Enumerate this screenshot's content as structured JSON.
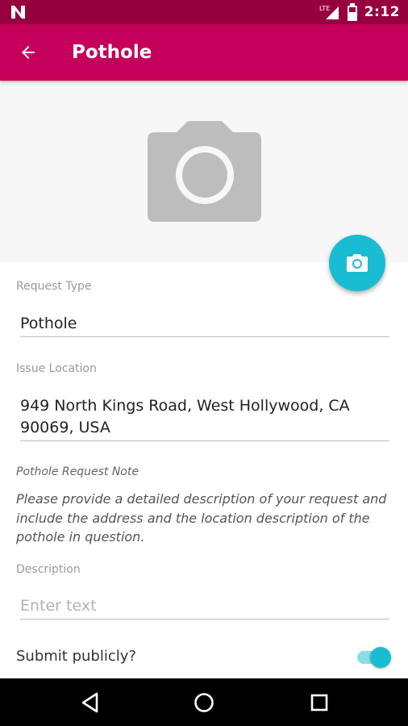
{
  "status_bar": {
    "network": "LTE",
    "time": "2:12"
  },
  "app_bar": {
    "title": "Pothole"
  },
  "form": {
    "request_type": {
      "label": "Request Type",
      "value": "Pothole"
    },
    "issue_location": {
      "label": "Issue Location",
      "value_line1": "949 North Kings Road, West Hollywood, CA",
      "value_line2": "90069, USA"
    },
    "note": {
      "title": "Pothole Request Note",
      "text": "Please provide a detailed description of your request and include the address and the location description of the pothole in question."
    },
    "description": {
      "label": "Description",
      "placeholder": "Enter text"
    },
    "submit_publicly": {
      "label": "Submit publicly?",
      "checked": true
    }
  },
  "colors": {
    "status_bar": "#97003f",
    "app_bar": "#c4005a",
    "accent": "#19bcd3"
  },
  "icons": {
    "back": "arrow-left-icon",
    "photo_placeholder": "camera-icon",
    "fab": "camera-icon",
    "nav_back": "triangle-back-icon",
    "nav_home": "circle-home-icon",
    "nav_recents": "square-recents-icon"
  }
}
